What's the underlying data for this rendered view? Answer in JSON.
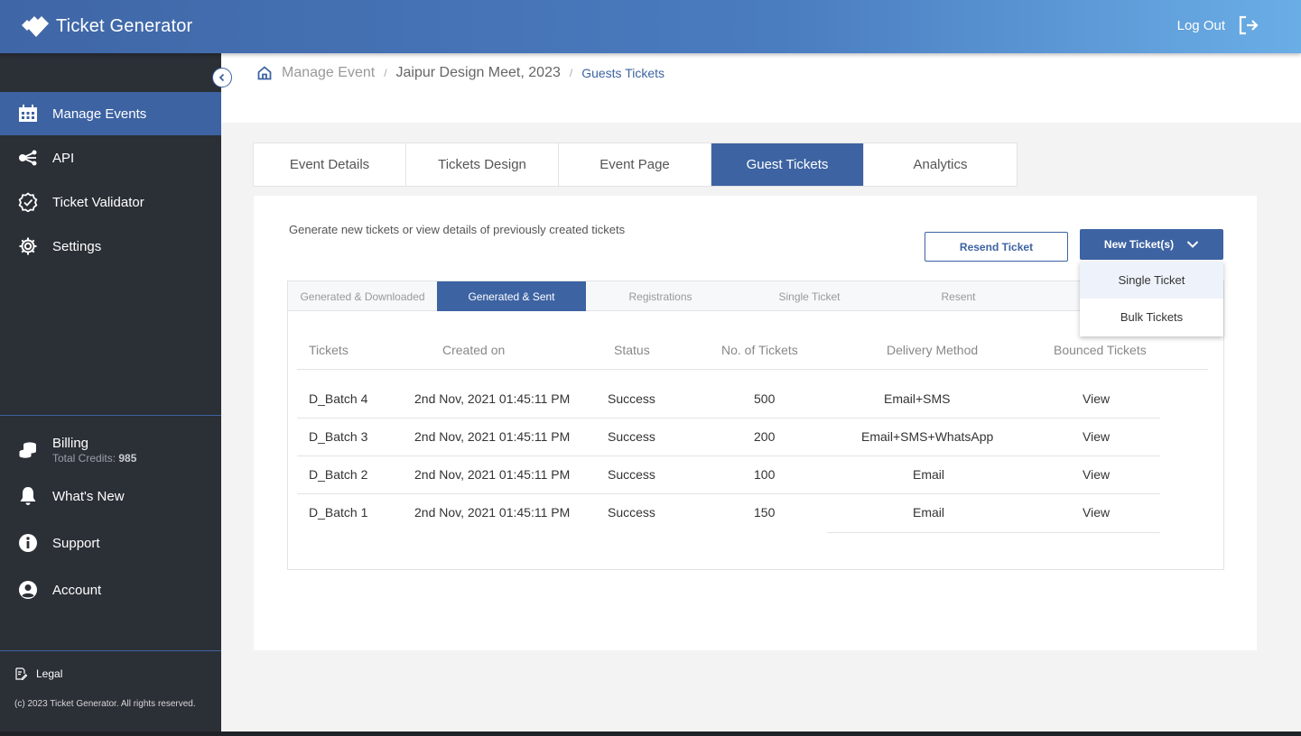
{
  "app": {
    "name": "Ticket Generator",
    "logout_label": "Log Out"
  },
  "sidebar": {
    "items": [
      {
        "label": "Manage Events",
        "icon": "calendar-icon",
        "active": true
      },
      {
        "label": "API",
        "icon": "share-icon"
      },
      {
        "label": "Ticket Validator",
        "icon": "badge-check-icon"
      },
      {
        "label": "Settings",
        "icon": "gear-icon"
      }
    ],
    "billing": {
      "label": "Billing",
      "credits_label": "Total Credits:",
      "credits_value": "985",
      "icon": "coins-icon"
    },
    "bottom_items": [
      {
        "label": "What's New",
        "icon": "bell-icon"
      },
      {
        "label": "Support",
        "icon": "info-icon"
      },
      {
        "label": "Account",
        "icon": "user-circle-icon"
      }
    ],
    "legal_label": "Legal",
    "copyright": "(c) 2023 Ticket Generator. All rights reserved."
  },
  "breadcrumb": {
    "items": [
      "Manage Event",
      "Jaipur Design Meet, 2023"
    ],
    "current": "Guests Tickets"
  },
  "tabs": [
    "Event Details",
    "Tickets Design",
    "Event Page",
    "Guest Tickets",
    "Analytics"
  ],
  "active_tab": "Guest Tickets",
  "panel": {
    "description": "Generate new tickets or view details of previously created tickets",
    "resend_label": "Resend Ticket",
    "new_label": "New Ticket(s)",
    "dropdown": [
      "Single Ticket",
      "Bulk Tickets"
    ]
  },
  "subtabs": [
    "Generated & Downloaded",
    "Generated & Sent",
    "Registrations",
    "Single Ticket",
    "Resent"
  ],
  "active_subtab": "Generated & Sent",
  "table": {
    "headers": [
      "Tickets",
      "Created on",
      "Status",
      "No. of Tickets",
      "Delivery Method",
      "Bounced Tickets"
    ],
    "rows": [
      [
        "D_Batch 4",
        "2nd Nov, 2021 01:45:11 PM",
        "Success",
        "500",
        "Email+SMS",
        "View"
      ],
      [
        "D_Batch 3",
        "2nd Nov, 2021 01:45:11 PM",
        "Success",
        "200",
        "Email+SMS+WhatsApp",
        "View"
      ],
      [
        "D_Batch 2",
        "2nd Nov, 2021 01:45:11 PM",
        "Success",
        "100",
        "Email",
        "View"
      ],
      [
        "D_Batch 1",
        "2nd Nov, 2021 01:45:11 PM",
        "Success",
        "150",
        "Email",
        "View"
      ]
    ]
  },
  "colors": {
    "primary": "#3d63a2",
    "sidebar_bg": "#2b2f36",
    "header_gradient_end": "#6aaee6"
  }
}
